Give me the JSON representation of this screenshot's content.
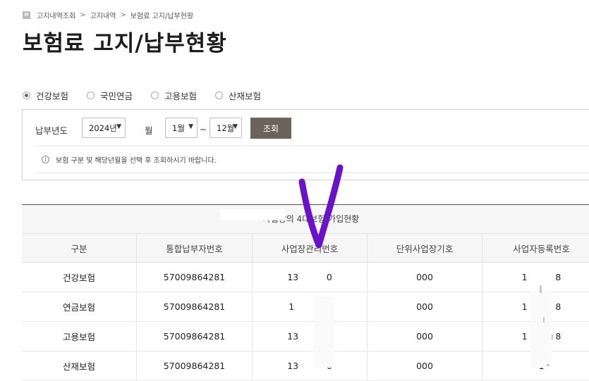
{
  "breadcrumb": {
    "home_icon_text": "H",
    "items": [
      "고지내역조회",
      "고지내역",
      "보험료 고지/납부현황"
    ],
    "separator": ">"
  },
  "page_title": "보험료 고지/납부현황",
  "insurance_types": [
    {
      "label": "건강보험",
      "checked": true
    },
    {
      "label": "국민연금",
      "checked": false
    },
    {
      "label": "고용보험",
      "checked": false
    },
    {
      "label": "산재보험",
      "checked": false
    }
  ],
  "search": {
    "year_label": "납부년도",
    "year_value": "2024년",
    "month_label": "월",
    "month_from": "1월",
    "range_sep": "~",
    "month_to": "12월",
    "submit_label": "조회",
    "notice_icon_text": "i",
    "notice": "보험 구분 및 해당년월을 선택 후 조회하시기 바랍니다."
  },
  "table": {
    "caption": "사업장의 4대보험 가입현황",
    "headers": [
      "구분",
      "통합납부자번호",
      "사업장관리번호",
      "단위사업장기호",
      "사업자등록번호"
    ],
    "rows": [
      [
        "건강보험",
        "57009864281",
        "13          0",
        "000",
        "1          8"
      ],
      [
        "연금보험",
        "57009864281",
        "1           0",
        "000",
        "1          8"
      ],
      [
        "고용보험",
        "57009864281",
        "13          0",
        "000",
        "1          8"
      ],
      [
        "산재보험",
        "57009864281",
        "13          0",
        "000",
        "1"
      ]
    ]
  },
  "colors": {
    "accent_button": "#6e635c",
    "check_annotation": "#6a12c9",
    "table_header_bg": "#f6f6f6"
  }
}
